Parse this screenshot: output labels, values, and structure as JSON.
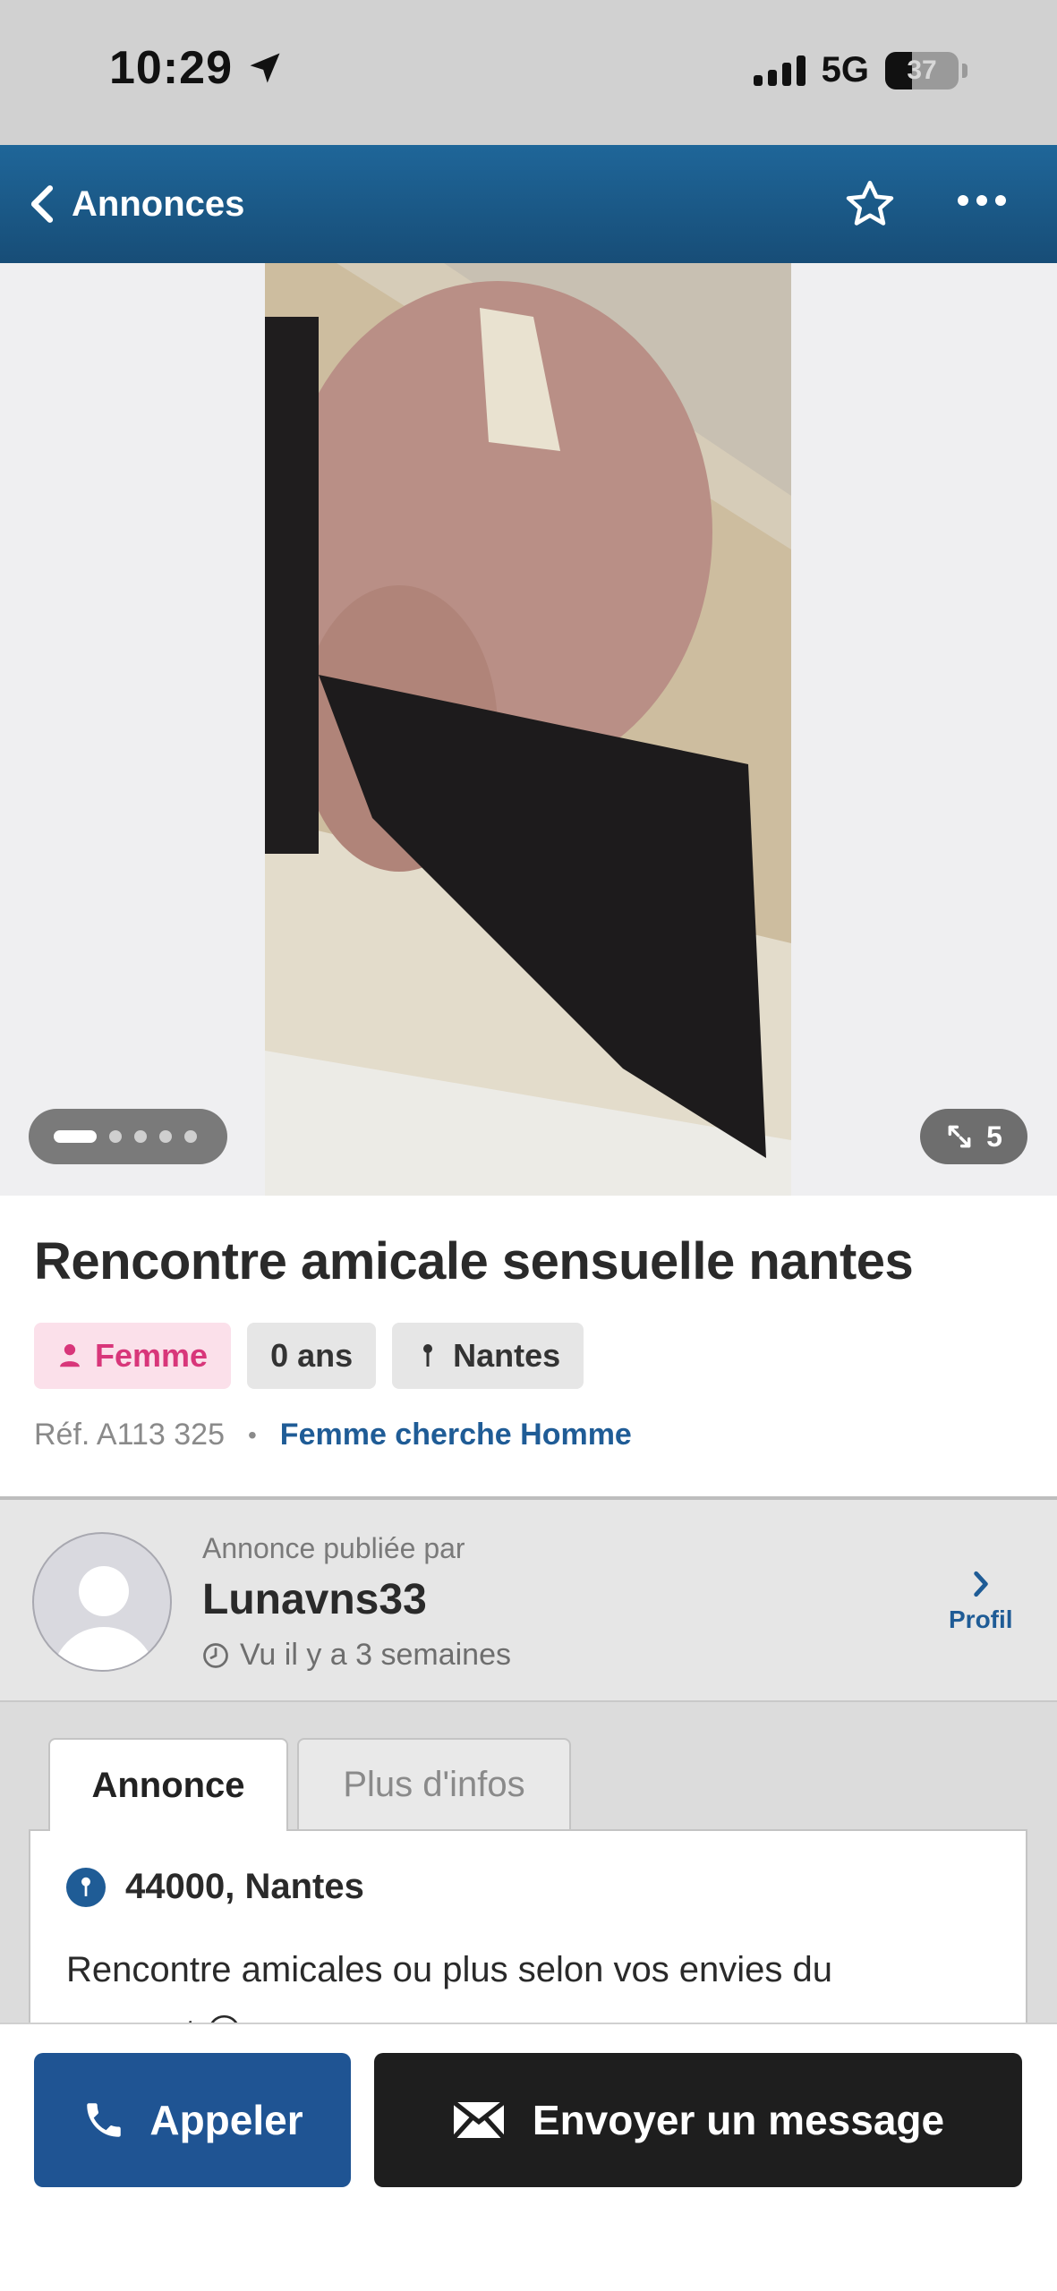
{
  "status_bar": {
    "time": "10:29",
    "network": "5G",
    "battery": "37",
    "battery_level": 0.37
  },
  "nav": {
    "back_label": "Annonces",
    "icons": [
      "chevron-left-icon",
      "star-outline-icon",
      "more-dots-icon"
    ]
  },
  "gallery": {
    "photo_count": "5",
    "current_index": 1,
    "dot_count": 5
  },
  "ad": {
    "title": "Rencontre amicale sensuelle nantes",
    "gender": "Femme",
    "age": "0 ans",
    "city": "Nantes",
    "reference": "Réf. A113 325",
    "separator": "•",
    "category": "Femme cherche Homme"
  },
  "author": {
    "published_by": "Annonce publiée par",
    "username": "Lunavns33",
    "last_seen": "Vu il y a 3 semaines",
    "profile_label": "Profil"
  },
  "tabs": [
    {
      "label": "Annonce",
      "active": true
    },
    {
      "label": "Plus d'infos",
      "active": false
    }
  ],
  "content": {
    "location": "44000, Nantes",
    "description": "Rencontre amicales ou plus selon vos envies du moment 😏"
  },
  "actions": {
    "call_label": "Appeler",
    "message_label": "Envoyer un message"
  },
  "colors": {
    "nav_blue": "#1f6699",
    "link_blue": "#1f5c96",
    "call_button": "#1f5493",
    "message_button": "#1e1e1e",
    "gender_chip_text": "#d8367a",
    "gender_chip_bg": "#fbe0ea"
  }
}
